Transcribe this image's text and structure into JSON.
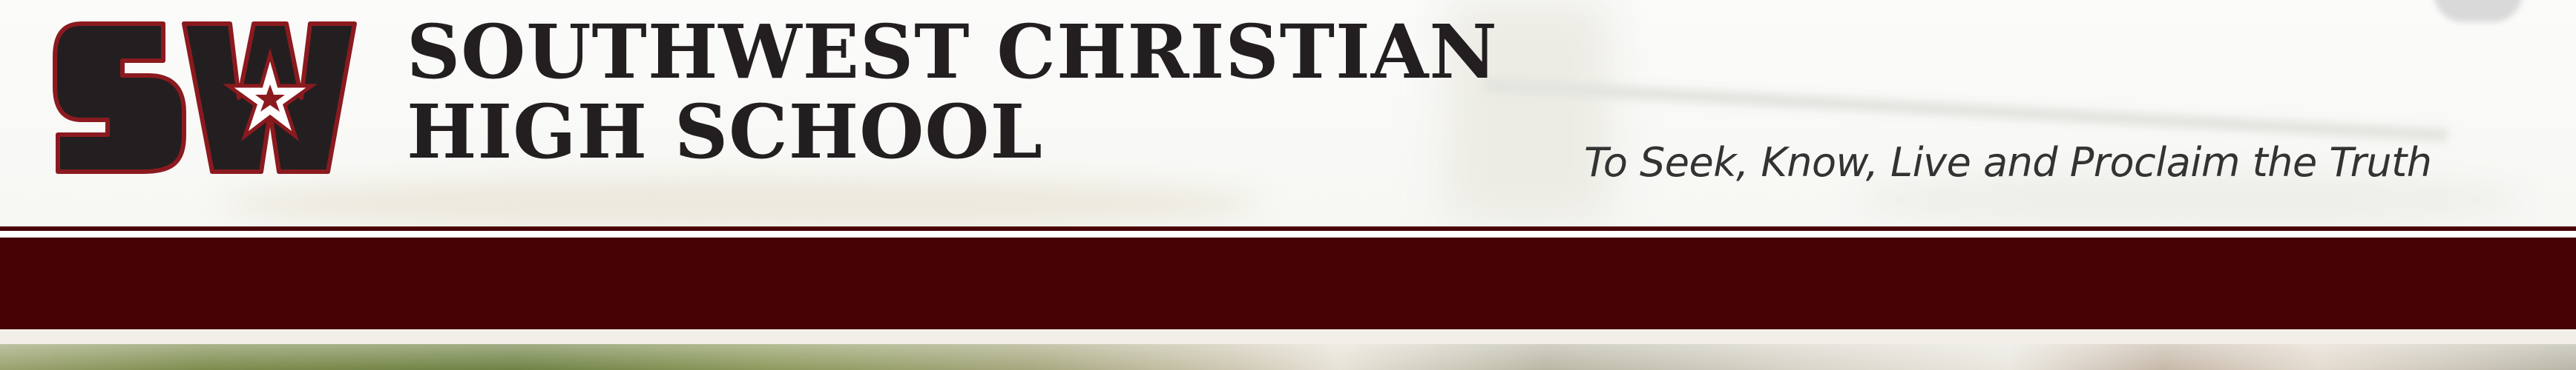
{
  "header": {
    "logo_text": "SW",
    "school_name_line1": "SOUTHWEST CHRISTIAN",
    "school_name_line2": "HIGH SCHOOL",
    "tagline": "To Seek, Know, Live and Proclaim the Truth"
  },
  "colors": {
    "brand_maroon": "#470205",
    "logo_black": "#231f20",
    "logo_red": "#8b1a1f"
  },
  "nav": {
    "items": []
  }
}
